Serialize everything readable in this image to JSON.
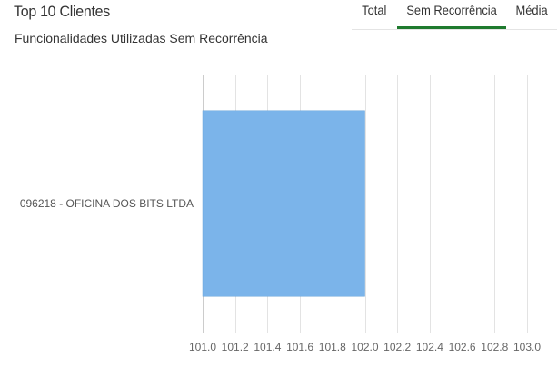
{
  "widget": {
    "title": "Top 10 Clientes"
  },
  "tabs": [
    {
      "label": "Total",
      "active": false
    },
    {
      "label": "Sem Recorrência",
      "active": true
    },
    {
      "label": "Média",
      "active": false
    }
  ],
  "colors": {
    "bar": "#7bb4ea",
    "tab_active": "#1e7a2e",
    "grid": "#e3e3e3"
  },
  "chart_data": {
    "type": "bar",
    "orientation": "horizontal",
    "title": "Funcionalidades Utilizadas Sem Recorrência",
    "categories": [
      "096218 - OFICINA DOS BITS LTDA"
    ],
    "values": [
      102.0
    ],
    "xlim": [
      101.0,
      103.0
    ],
    "xticks": [
      "101.0",
      "101.2",
      "101.4",
      "101.6",
      "101.8",
      "102.0",
      "102.2",
      "102.4",
      "102.6",
      "102.8",
      "103.0"
    ],
    "grid": true,
    "legend": "none"
  }
}
